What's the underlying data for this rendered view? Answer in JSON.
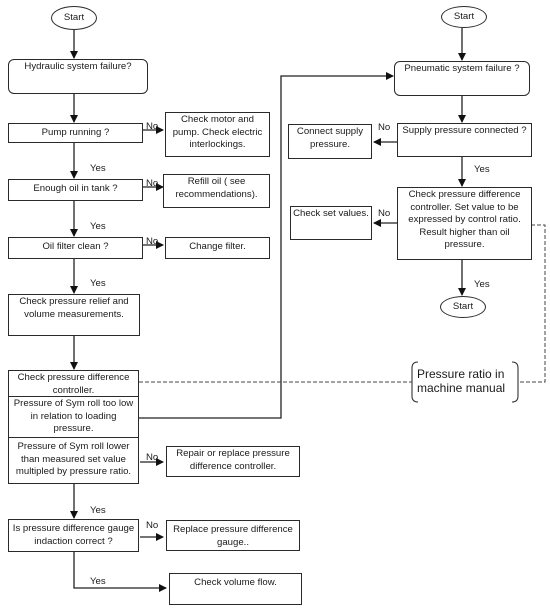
{
  "diagram": {
    "type": "flowchart",
    "left": {
      "start": "Start",
      "hydraulic": "Hydraulic system failure?",
      "pump": "Pump running ?",
      "pump_no": "Check motor and pump. Check electric interlockings.",
      "oil": "Enough oil in tank ?",
      "oil_no": "Refill oil ( see recommendations).",
      "filter": "Oil filter clean ?",
      "filter_no": "Change filter.",
      "relief": "Check pressure relief and volume measurements.",
      "pdc": "Check pressure difference controller.",
      "sym_low": "Pressure of Sym roll too low in relation to loading pressure.",
      "sym_lower": "Pressure of Sym roll lower than measured set value multipled by pressure ratio.",
      "sym_no": "Repair or replace pressure difference controller.",
      "gauge": "Is pressure difference gauge indaction correct ?",
      "gauge_no": "Replace pressure difference gauge..",
      "flow": "Check volume flow."
    },
    "right": {
      "start": "Start",
      "pneumatic": "Pneumatic system failure ?",
      "supply": "Supply pressure connected ?",
      "supply_no": "Connect supply pressure.",
      "pdc": "Check pressure difference controller. Set value to be expressed by control ratio. Result higher than oil pressure.",
      "pdc_no": "Check set values.",
      "end": "Start"
    },
    "note": "Pressure ratio in machine manual",
    "labels": {
      "yes": "Yes",
      "no": "No"
    }
  }
}
